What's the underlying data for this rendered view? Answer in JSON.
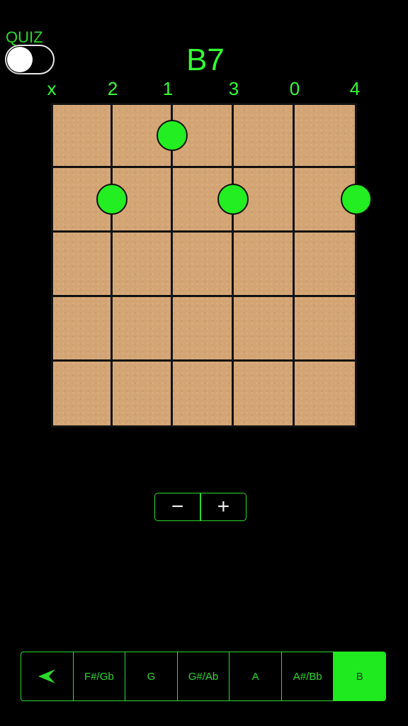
{
  "quiz": {
    "label": "QUIZ",
    "enabled": false
  },
  "chord": {
    "name": "B7"
  },
  "fingering": [
    "x",
    "2",
    "1",
    "3",
    "0",
    "4"
  ],
  "diagram": {
    "strings": 6,
    "frets_shown": 5,
    "dots": [
      {
        "string": 3,
        "fret": 1
      },
      {
        "string": 2,
        "fret": 2
      },
      {
        "string": 4,
        "fret": 2
      },
      {
        "string": 6,
        "fret": 2
      }
    ]
  },
  "stepper": {
    "minus": "−",
    "plus": "+"
  },
  "keys": {
    "items": [
      "F#/Gb",
      "G",
      "G#/Ab",
      "A",
      "A#/Bb",
      "B"
    ],
    "selected": "B"
  },
  "colors": {
    "accent": "#33ff33",
    "fretboard": "#d4a574"
  },
  "icons": {
    "back": "left-arrow-icon"
  }
}
